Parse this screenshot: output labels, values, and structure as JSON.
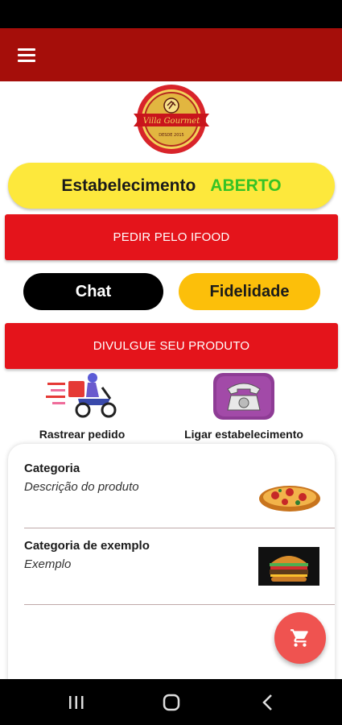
{
  "logo": {
    "name": "Villa Gourmet",
    "tagline": "DESDE 2015"
  },
  "status": {
    "label": "Estabelecimento",
    "value": "ABERTO",
    "value_color": "#36c325"
  },
  "buttons": {
    "ifood": "PEDIR PELO IFOOD",
    "chat": "Chat",
    "fidelidade": "Fidelidade",
    "divulgue": "DIVULGUE SEU PRODUTO"
  },
  "actions": {
    "track": {
      "label": "Rastrear pedido",
      "icon": "delivery-scooter-icon"
    },
    "call": {
      "label": "Ligar estabelecimento",
      "icon": "telephone-icon"
    }
  },
  "products": [
    {
      "title": "Categoria",
      "description": "Descrição do produto",
      "image": "pizza"
    },
    {
      "title": "Categoria de exemplo",
      "description": "Exemplo",
      "image": "burger"
    }
  ],
  "colors": {
    "app_bar": "#a50e0a",
    "primary_red": "#e4141b",
    "status_yellow": "#fde83c",
    "fidelidade_yellow": "#fcbf0a",
    "fab": "#ef5350"
  }
}
